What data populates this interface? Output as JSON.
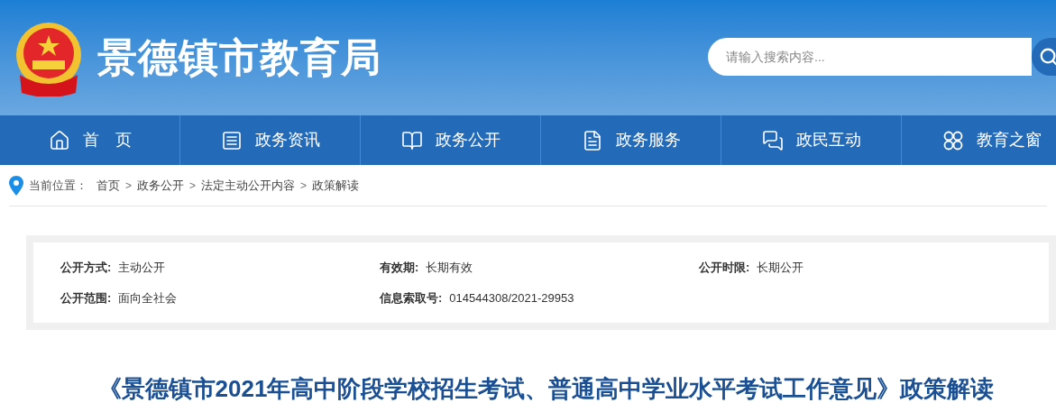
{
  "header": {
    "site_title": "景德镇市教育局",
    "search": {
      "placeholder": "请输入搜索内容..."
    }
  },
  "nav": [
    {
      "label": "首　页",
      "kind": "home"
    },
    {
      "label": "政务资讯",
      "kind": "news"
    },
    {
      "label": "政务公开",
      "kind": "book"
    },
    {
      "label": "政务服务",
      "kind": "doc"
    },
    {
      "label": "政民互动",
      "kind": "chat"
    },
    {
      "label": "教育之窗",
      "kind": "grid"
    }
  ],
  "breadcrumb": {
    "prefix": "当前位置：",
    "trail": [
      {
        "kind": "link",
        "text": "首页"
      },
      {
        "kind": "separator",
        "text": ">"
      },
      {
        "kind": "link",
        "text": "政务公开"
      },
      {
        "kind": "separator",
        "text": ">"
      },
      {
        "kind": "link",
        "text": "法定主动公开内容"
      },
      {
        "kind": "separator",
        "text": ">"
      },
      {
        "kind": "link",
        "text": "政策解读"
      }
    ]
  },
  "info": [
    [
      {
        "label": "公开方式:",
        "value": "主动公开"
      },
      {
        "label": "有效期:",
        "value": "长期有效"
      },
      {
        "label": "公开时限:",
        "value": "长期公开"
      }
    ],
    [
      {
        "label": "公开范围:",
        "value": "面向全社会"
      },
      {
        "label": "信息索取号:",
        "value": "014544308/2021-29953"
      }
    ]
  ],
  "article": {
    "title": "《景德镇市2021年高中阶段学校招生考试、普通高中学业水平考试工作意见》政策解读"
  }
}
